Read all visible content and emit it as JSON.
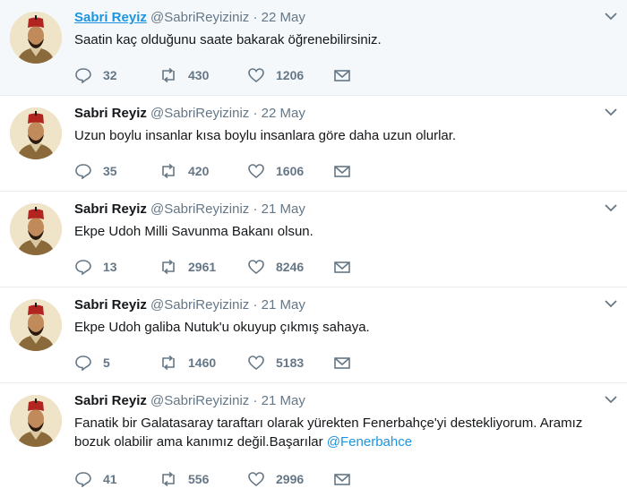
{
  "tweets": [
    {
      "name": "Sabri Reyiz",
      "handle": "@SabriReyiziniz",
      "date": "22 May",
      "text": "Saatin kaç olduğunu saate bakarak öğrenebilirsiniz.",
      "mention": "",
      "replies": "32",
      "retweets": "430",
      "likes": "1206"
    },
    {
      "name": "Sabri Reyiz",
      "handle": "@SabriReyiziniz",
      "date": "22 May",
      "text": "Uzun boylu insanlar kısa boylu insanlara göre daha uzun olurlar.",
      "mention": "",
      "replies": "35",
      "retweets": "420",
      "likes": "1606"
    },
    {
      "name": "Sabri Reyiz",
      "handle": "@SabriReyiziniz",
      "date": "21 May",
      "text": "Ekpe Udoh Milli Savunma Bakanı olsun.",
      "mention": "",
      "replies": "13",
      "retweets": "2961",
      "likes": "8246"
    },
    {
      "name": "Sabri Reyiz",
      "handle": "@SabriReyiziniz",
      "date": "21 May",
      "text": "Ekpe Udoh galiba Nutuk'u okuyup çıkmış sahaya.",
      "mention": "",
      "replies": "5",
      "retweets": "1460",
      "likes": "5183"
    },
    {
      "name": "Sabri Reyiz",
      "handle": "@SabriReyiziniz",
      "date": "21 May",
      "text": "Fanatik bir Galatasaray taraftarı olarak yürekten Fenerbahçe'yi destekliyorum. Aramız bozuk olabilir ama kanımız değil.Başarılar ",
      "mention": "@Fenerbahce",
      "replies": "41",
      "retweets": "556",
      "likes": "2996"
    }
  ],
  "icons": {
    "reply": "reply-icon",
    "retweet": "retweet-icon",
    "like": "heart-icon",
    "dm": "envelope-icon",
    "menu": "chevron-down-icon"
  },
  "colors": {
    "link": "#1b95e0",
    "muted": "#657786",
    "hover_bg": "#f5f8fa"
  }
}
